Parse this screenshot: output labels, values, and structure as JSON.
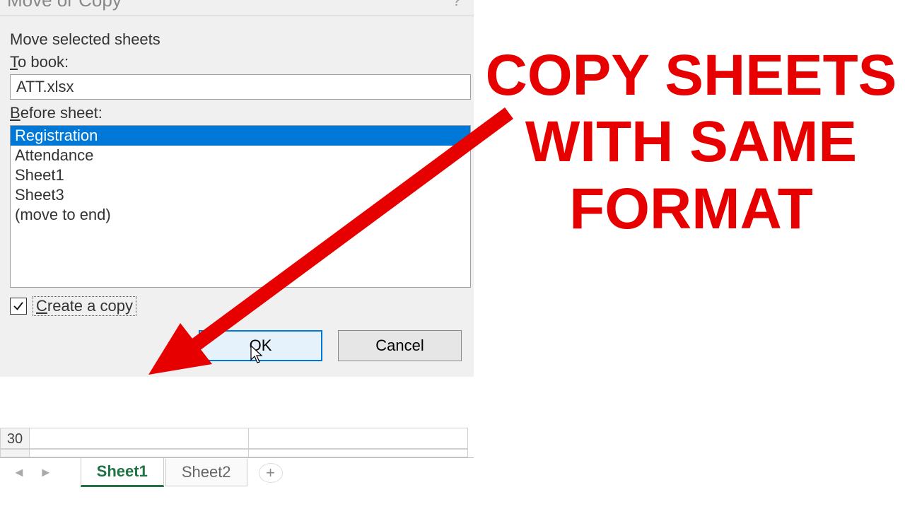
{
  "dialog": {
    "title": "Move or Copy",
    "help_hint": "?",
    "move_label": "Move selected sheets",
    "to_book_label_pre": "T",
    "to_book_label_post": "o book:",
    "to_book_value": "ATT.xlsx",
    "before_sheet_label_pre": "B",
    "before_sheet_label_post": "efore sheet:",
    "sheet_list": [
      {
        "label": "Registration",
        "selected": true
      },
      {
        "label": "Attendance",
        "selected": false
      },
      {
        "label": "Sheet1",
        "selected": false
      },
      {
        "label": "Sheet3",
        "selected": false
      },
      {
        "label": "(move to end)",
        "selected": false
      }
    ],
    "create_copy_label_pre": "C",
    "create_copy_label_post": "reate a copy",
    "create_copy_checked": true,
    "ok_label_pre": "O",
    "ok_label_post": "K",
    "cancel_label": "Cancel"
  },
  "worksheet": {
    "row_header": "30",
    "tabs": [
      {
        "label": "Sheet1",
        "active": true
      },
      {
        "label": "Sheet2",
        "active": false
      }
    ]
  },
  "annotation": {
    "line1": "COPY SHEETS",
    "line2": "WITH SAME",
    "line3": "FORMAT"
  }
}
